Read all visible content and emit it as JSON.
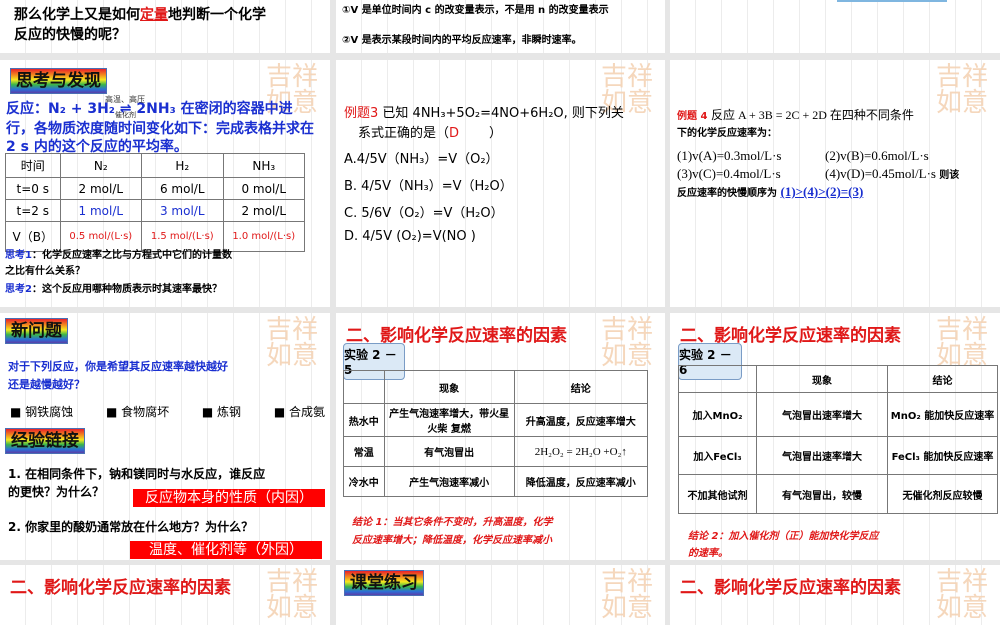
{
  "watermark": "吉祥如意",
  "slide_top_left": {
    "line1_a": "那么化学上又是如何",
    "line1_hl": "定量",
    "line1_b": "地判断一个化学",
    "line2": "反应的快慢的呢？"
  },
  "slide_top_mid": {
    "line1": "①V 是单位时间内 c 的改变量表示，不是用 n 的改变量表示",
    "line2": "②V 是表示某段时间内的平均反应速率，非瞬时速率。"
  },
  "slide_think": {
    "label": "思考与发现",
    "reaction": "反应：N₂ + 3H₂ ⇌ 2NH₃ 在密闭的容器中进",
    "conditions_top": "高温、高压",
    "conditions_bottom": "催化剂",
    "line2": "行，各物质浓度随时间变化如下：完成表格并求在",
    "line3": "2 s 内的这个反应的平均率。",
    "table": {
      "headers": [
        "时间",
        "N₂",
        "H₂",
        "NH₃"
      ],
      "rows": [
        [
          "t=0 s",
          "2 mol/L",
          "6 mol/L",
          "0 mol/L"
        ],
        [
          "t=2 s",
          "1 mol/L",
          "3 mol/L",
          "2 mol/L"
        ],
        [
          "V（B）",
          "0.5 mol/(L·s)",
          "1.5 mol/(L·s)",
          "1.0 mol/(L·s)"
        ]
      ]
    },
    "think1_label": "思考1",
    "think1": "：化学反应速率之比与方程式中它们的计量数",
    "think1_b": "之比有什么关系？",
    "think2_label": "思考2",
    "think2": "：这个反应用哪种物质表示时其速率最快？"
  },
  "slide_ex3": {
    "label": "例题3",
    "stem": "已知 4NH₃+5O₂=4NO+6H₂O, 则下列关",
    "stem2": "系式正确的是（",
    "answer": "D",
    "close": "）",
    "options": [
      "A.4/5V（NH₃）=V（O₂）",
      "B. 4/5V（NH₃）=V（H₂O）",
      "C. 5/6V（O₂）=V（H₂O）",
      "D. 4/5V (O₂)=V(NO )"
    ]
  },
  "slide_ex4": {
    "label": "例题 4",
    "stem": "反应 A + 3B = 2C + 2D 在四种不同条件",
    "stem2": "下的化学反应速率为：",
    "items": [
      "(1)v(A)=0.3mol/L·s",
      "(2)v(B)=0.6mol/L·s",
      "(3)v(C)=0.4mol/L·s",
      "(4)v(D)=0.45mol/L·s"
    ],
    "tail": "则该",
    "order_label": "反应速率的快慢顺序为",
    "answer": "(1)>(4)>(2)=(3)"
  },
  "slide_new": {
    "label": "新问题",
    "q1": "对于下列反应，你是希望其反应速率越快越好",
    "q2": "还是越慢越好？",
    "bullets": [
      "钢铁腐蚀",
      "食物腐坏",
      "炼钢",
      "合成氨"
    ],
    "label2": "经验链接",
    "e1": "1. 在相同条件下，钠和镁同时与水反应，谁反应",
    "e1b": "的更快？为什么？",
    "a1": "反应物本身的性质（内因）",
    "e2": "2. 你家里的酸奶通常放在什么地方？为什么？",
    "a2": "温度、催化剂等（外因）"
  },
  "slide_exp25": {
    "title": "二、影响化学反应速率的因素",
    "label": "实验 2 － 5",
    "headers": [
      "",
      "现象",
      "结论"
    ],
    "rows": [
      [
        "热水中",
        "产生气泡速率增大，带火星火柴 复燃",
        "升高温度，反应速率增大"
      ],
      [
        "常温",
        "有气泡冒出",
        "2H₂O₂ = 2H₂O +O₂↑"
      ],
      [
        "冷水中",
        "产生气泡速率减小",
        "降低温度，反应速率减小"
      ]
    ],
    "conclusion": "结论 1：当其它条件不变时，升高温度，化学",
    "conclusion2": "反应速率增大；降低温度，化学反应速率减小"
  },
  "slide_exp26": {
    "title": "二、影响化学反应速率的因素",
    "label": "实验 2 － 6",
    "headers": [
      "",
      "现象",
      "结论"
    ],
    "rows": [
      [
        "加入MnO₂",
        "气泡冒出速率增大",
        "MnO₂ 能加快反应速率"
      ],
      [
        "加入FeCl₃",
        "气泡冒出速率增大",
        "FeCl₃ 能加快反应速率"
      ],
      [
        "不加其他试剂",
        "有气泡冒出，较慢",
        "无催化剂反应较慢"
      ]
    ],
    "conclusion": "结论 2：加入催化剂（正）能加快化学反应",
    "conclusion2": "的速率。"
  },
  "bottom": {
    "left_title": "二、影响化学反应速率的因素",
    "mid_label": "课堂练习",
    "right_title": "二、影响化学反应速率的因素"
  }
}
